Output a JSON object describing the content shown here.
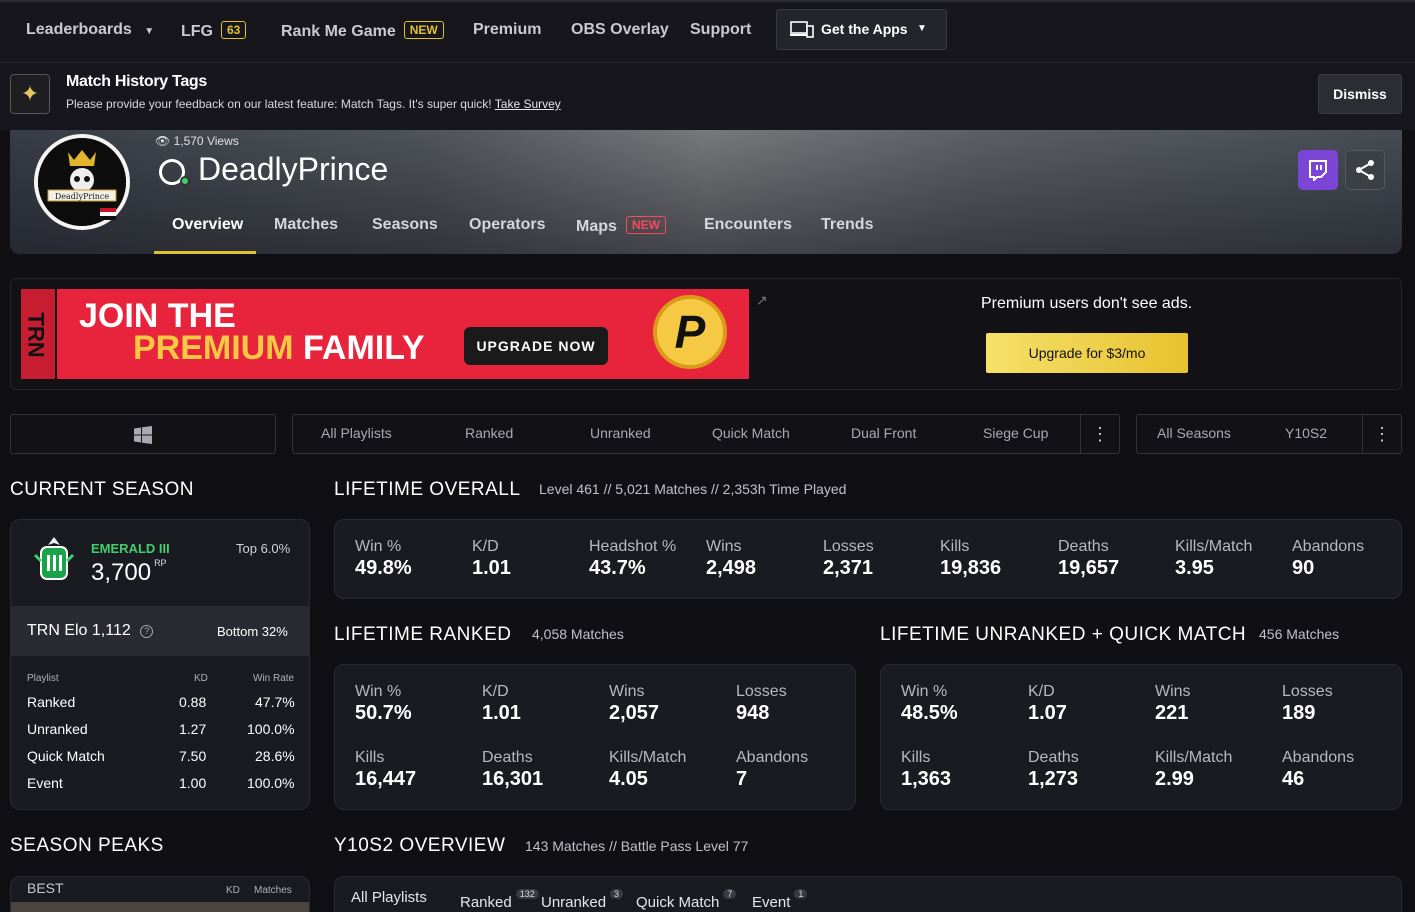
{
  "nav": {
    "leaderboards": "Leaderboards",
    "lfg": "LFG",
    "lfg_count": "63",
    "rank_me": "Rank Me Game",
    "rank_me_badge": "NEW",
    "premium": "Premium",
    "obs": "OBS Overlay",
    "support": "Support",
    "get_apps": "Get the Apps"
  },
  "announcement": {
    "title": "Match History Tags",
    "text": "Please provide your feedback on our latest feature: Match Tags. It's super quick!",
    "link": "Take Survey",
    "dismiss": "Dismiss"
  },
  "profile": {
    "views": "1,570 Views",
    "name": "DeadlyPrince",
    "avatar_text": "DeadlyPrince",
    "tabs": [
      "Overview",
      "Matches",
      "Seasons",
      "Operators",
      "Maps",
      "Encounters",
      "Trends"
    ],
    "maps_badge": "NEW"
  },
  "ad": {
    "banner_line1": "JOIN THE",
    "banner_line2a": "PREMIUM",
    "banner_line2b": "FAMILY",
    "banner_cta": "UPGRADE NOW",
    "banner_logo": "P",
    "brand": "TRN",
    "note": "Premium users don't see ads.",
    "upgrade": "Upgrade for $3/mo"
  },
  "filters": {
    "playlists": [
      "All Playlists",
      "Ranked",
      "Unranked",
      "Quick Match",
      "Dual Front",
      "Siege Cup"
    ],
    "seasons": [
      "All Seasons",
      "Y10S2"
    ]
  },
  "current_season": {
    "title": "CURRENT SEASON",
    "rank": "EMERALD III",
    "rp": "3,700",
    "rp_label": "RP",
    "top": "Top 6.0%",
    "elo": "TRN Elo 1,112",
    "elo_rank": "Bottom 32%",
    "headers": [
      "Playlist",
      "KD",
      "Win Rate"
    ],
    "rows": [
      {
        "playlist": "Ranked",
        "kd": "0.88",
        "win": "47.7%"
      },
      {
        "playlist": "Unranked",
        "kd": "1.27",
        "win": "100.0%"
      },
      {
        "playlist": "Quick Match",
        "kd": "7.50",
        "win": "28.6%"
      },
      {
        "playlist": "Event",
        "kd": "1.00",
        "win": "100.0%"
      }
    ]
  },
  "lifetime_overall": {
    "title": "LIFETIME OVERALL",
    "sub": "Level 461 // 5,021 Matches // 2,353h Time Played",
    "stats": [
      {
        "label": "Win %",
        "value": "49.8%"
      },
      {
        "label": "K/D",
        "value": "1.01"
      },
      {
        "label": "Headshot %",
        "value": "43.7%"
      },
      {
        "label": "Wins",
        "value": "2,498"
      },
      {
        "label": "Losses",
        "value": "2,371"
      },
      {
        "label": "Kills",
        "value": "19,836"
      },
      {
        "label": "Deaths",
        "value": "19,657"
      },
      {
        "label": "Kills/Match",
        "value": "3.95"
      },
      {
        "label": "Abandons",
        "value": "90"
      }
    ]
  },
  "lifetime_ranked": {
    "title": "LIFETIME RANKED",
    "sub": "4,058 Matches",
    "stats": [
      {
        "label": "Win %",
        "value": "50.7%"
      },
      {
        "label": "K/D",
        "value": "1.01"
      },
      {
        "label": "Wins",
        "value": "2,057"
      },
      {
        "label": "Losses",
        "value": "948"
      },
      {
        "label": "Kills",
        "value": "16,447"
      },
      {
        "label": "Deaths",
        "value": "16,301"
      },
      {
        "label": "Kills/Match",
        "value": "4.05"
      },
      {
        "label": "Abandons",
        "value": "7"
      }
    ]
  },
  "lifetime_unranked": {
    "title": "LIFETIME UNRANKED + QUICK MATCH",
    "sub": "456 Matches",
    "stats": [
      {
        "label": "Win %",
        "value": "48.5%"
      },
      {
        "label": "K/D",
        "value": "1.07"
      },
      {
        "label": "Wins",
        "value": "221"
      },
      {
        "label": "Losses",
        "value": "189"
      },
      {
        "label": "Kills",
        "value": "1,363"
      },
      {
        "label": "Deaths",
        "value": "1,273"
      },
      {
        "label": "Kills/Match",
        "value": "2.99"
      },
      {
        "label": "Abandons",
        "value": "46"
      }
    ]
  },
  "season_peaks": {
    "title": "SEASON PEAKS",
    "best": "BEST",
    "kd": "KD",
    "matches": "Matches"
  },
  "season_overview": {
    "title": "Y10S2 OVERVIEW",
    "sub": "143 Matches //  Battle Pass Level 77",
    "tabs": [
      {
        "label": "All Playlists",
        "count": ""
      },
      {
        "label": "Ranked",
        "count": "132"
      },
      {
        "label": "Unranked",
        "count": "3"
      },
      {
        "label": "Quick Match",
        "count": "7"
      },
      {
        "label": "Event",
        "count": "1"
      }
    ]
  },
  "colors": {
    "accent": "#e3c12a",
    "emerald": "#3ecf6e",
    "badge_red": "#ff4757"
  }
}
